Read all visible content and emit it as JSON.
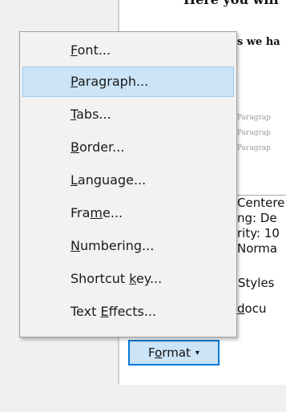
{
  "document": {
    "line1": "Here you will",
    "line2": "s we ha",
    "preview_lines": [
      "Paragrap",
      "Paragrap",
      "Paragrap"
    ],
    "description": [
      "Centere",
      "ng:  De",
      "rity: 10",
      " Norma"
    ],
    "styles_label": "Styles",
    "document_label_prefix": "",
    "document_label_underlined": "d",
    "document_label_rest": "ocu"
  },
  "format_button": {
    "label_pre": "F",
    "label_underlined": "o",
    "label_post": "rmat",
    "caret": "▾"
  },
  "menu": {
    "items": [
      {
        "pre": "",
        "u": "F",
        "post": "ont...",
        "hover": false
      },
      {
        "pre": "",
        "u": "P",
        "post": "aragraph...",
        "hover": true
      },
      {
        "pre": "",
        "u": "T",
        "post": "abs...",
        "hover": false
      },
      {
        "pre": "",
        "u": "B",
        "post": "order...",
        "hover": false
      },
      {
        "pre": "",
        "u": "L",
        "post": "anguage...",
        "hover": false
      },
      {
        "pre": "Fra",
        "u": "m",
        "post": "e...",
        "hover": false
      },
      {
        "pre": "",
        "u": "N",
        "post": "umbering...",
        "hover": false
      },
      {
        "pre": "Shortcut ",
        "u": "k",
        "post": "ey...",
        "hover": false
      },
      {
        "pre": "Text ",
        "u": "E",
        "post": "ffects...",
        "hover": false
      }
    ]
  }
}
